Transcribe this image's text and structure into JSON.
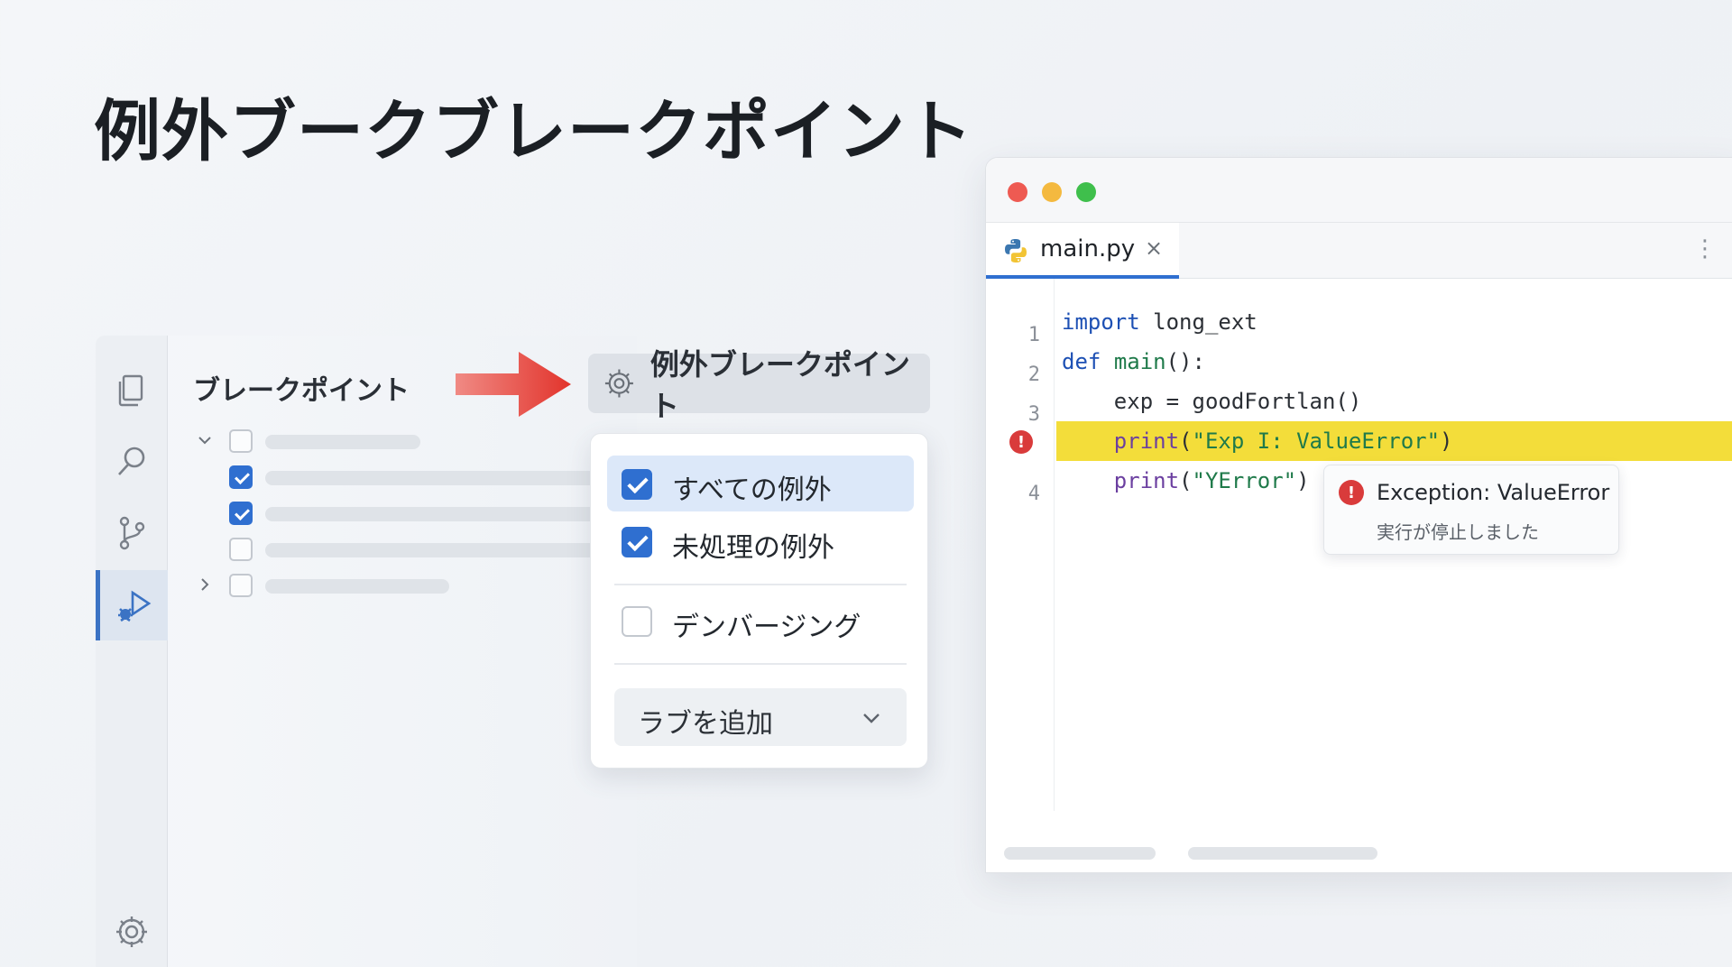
{
  "page": {
    "title": "例外ブークブレークポイント"
  },
  "breakpoints_panel": {
    "title": "ブレークポイント",
    "rows": [
      {
        "checked": false,
        "expanded": true
      },
      {
        "checked": true
      },
      {
        "checked": true
      },
      {
        "checked": false
      },
      {
        "checked": false,
        "expanded": false
      }
    ]
  },
  "exception_button": {
    "label": "例外ブレークポイント",
    "icon": "gear-icon"
  },
  "exception_menu": {
    "options": [
      {
        "label": "すべての例外",
        "checked": true,
        "highlighted": true
      },
      {
        "label": "未処理の例外",
        "checked": true,
        "highlighted": false
      },
      {
        "label": "デンバージング",
        "checked": false,
        "highlighted": false
      }
    ],
    "select": {
      "label": "ラブを追加"
    }
  },
  "editor": {
    "tab": {
      "filename": "main.py",
      "close": "×"
    },
    "more": "⋮",
    "lines": [
      {
        "no": "1"
      },
      {
        "no": "2"
      },
      {
        "no": "3"
      },
      {
        "no": ""
      },
      {
        "no": "4"
      }
    ],
    "tooltip": {
      "title": "Exception: ValueError",
      "subtitle": "実行が停止しました"
    }
  },
  "colors": {
    "accent": "#2f6fd0",
    "highlight_line": "#f3dd3a",
    "error": "#d93b3b",
    "arrow": "#e2423b"
  }
}
